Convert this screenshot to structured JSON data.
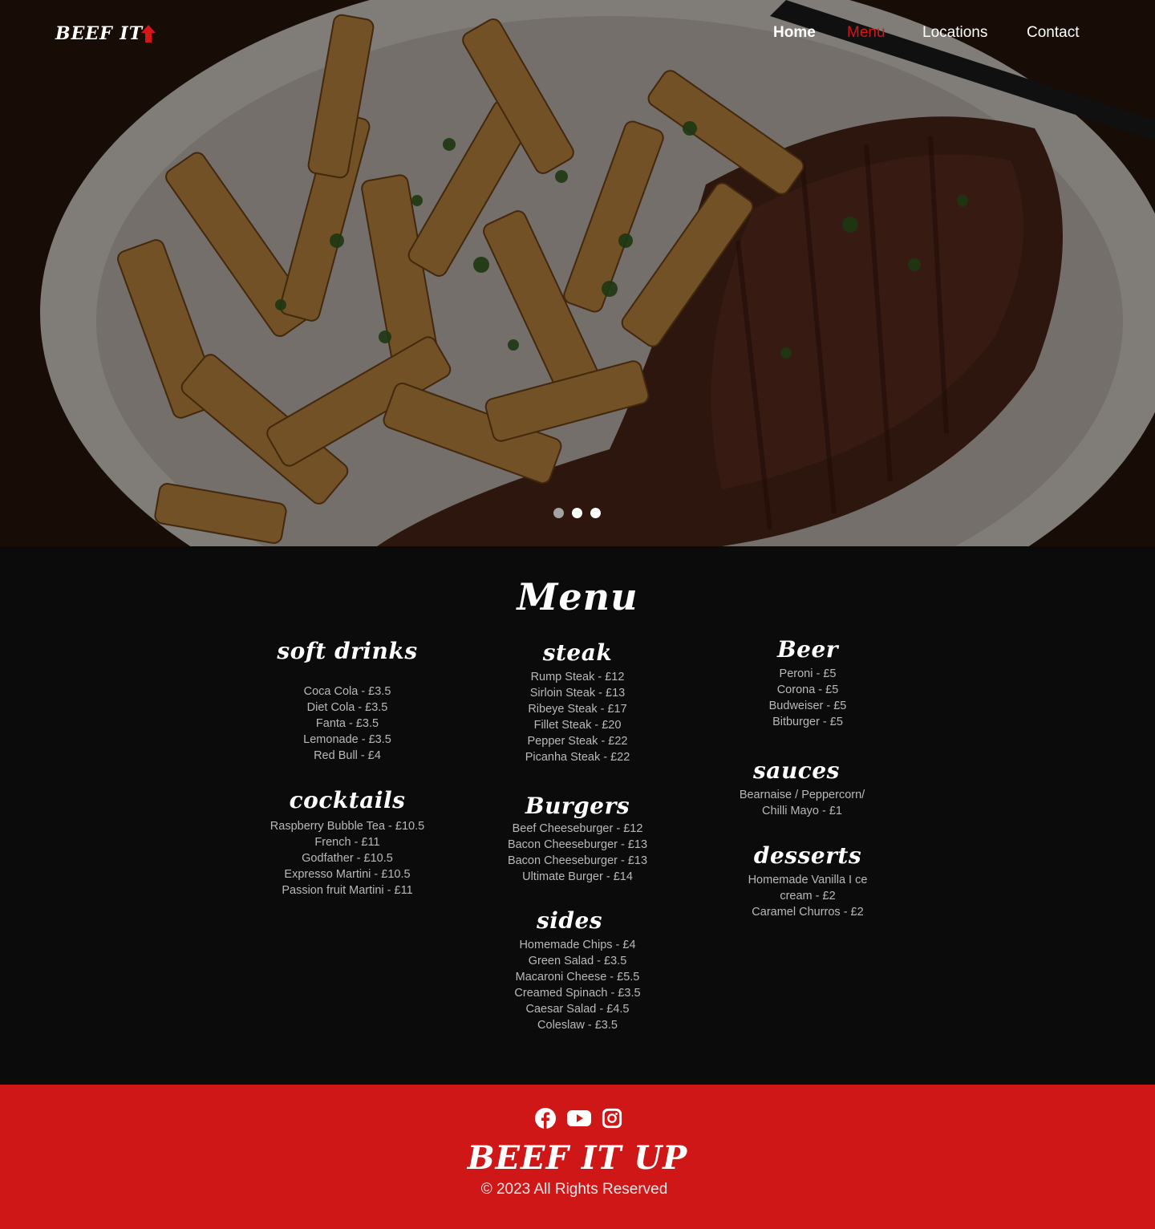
{
  "header": {
    "logo_text": "BEEF IT",
    "nav": {
      "home": "Home",
      "menu": "Menu",
      "locations": "Locations",
      "contact": "Contact"
    }
  },
  "menu": {
    "title": "Menu",
    "soft_drinks": {
      "heading": "soft drinks",
      "items": [
        "Coca Cola - £3.5",
        "Diet Cola - £3.5",
        "Fanta - £3.5",
        "Lemonade - £3.5",
        "Red Bull - £4"
      ]
    },
    "cocktails": {
      "heading": "cocktails",
      "items": [
        "Raspberry Bubble Tea - £10.5",
        "French - £11",
        "Godfather - £10.5",
        "Expresso Martini - £10.5",
        "Passion fruit Martini - £11"
      ]
    },
    "steak": {
      "heading": "steak",
      "items": [
        "Rump Steak - £12",
        "Sirloin Steak - £13",
        "Ribeye Steak - £17",
        "Fillet Steak - £20",
        "Pepper Steak - £22",
        "Picanha Steak - £22"
      ]
    },
    "burgers": {
      "heading": "Burgers",
      "items": [
        "Beef Cheeseburger - £12",
        "Bacon Cheeseburger -  £13",
        "Bacon Cheeseburger -  £13",
        "Ultimate Burger - £14"
      ]
    },
    "sides": {
      "heading": "sides",
      "items": [
        "Homemade Chips - £4",
        "Green Salad -  £3.5",
        "Macaroni Cheese - £5.5",
        "Creamed Spinach - £3.5",
        "Caesar Salad - £4.5",
        "Coleslaw - £3.5"
      ]
    },
    "beer": {
      "heading": "Beer",
      "items": [
        "Peroni -  £5",
        "Corona - £5",
        "Budweiser - £5",
        "Bitburger - £5"
      ]
    },
    "sauces": {
      "heading": "sauces",
      "items": [
        "Bearnaise / Peppercorn/",
        "Chilli Mayo - £1"
      ]
    },
    "desserts": {
      "heading": "desserts",
      "items": [
        "Homemade Vanilla I ce",
        "cream - £2",
        "Caramel Churros - £2"
      ]
    }
  },
  "footer": {
    "brand": "BEEF IT UP",
    "copyright": "© 2023 All Rights Reserved",
    "social_icons": [
      "facebook-icon",
      "youtube-icon",
      "instagram-icon"
    ]
  },
  "colors": {
    "accent": "#d01717",
    "menu_bg": "#0b0b0b",
    "item_text": "#b9b9b9"
  },
  "carousel": {
    "slides": 3
  }
}
